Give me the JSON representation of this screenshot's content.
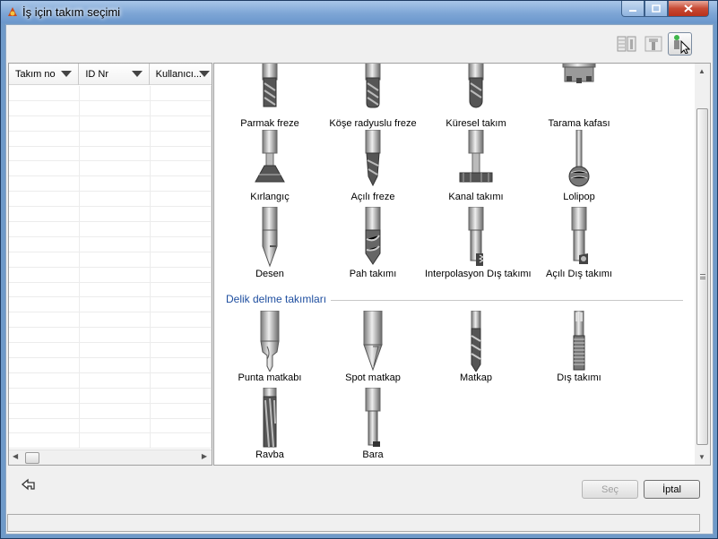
{
  "window": {
    "title": "İş için takım seçimi",
    "accent": "#6f9ac9"
  },
  "titlebar_buttons": {
    "minimize_icon": "minimize-icon",
    "maximize_icon": "maximize-icon",
    "close_icon": "close-icon"
  },
  "view_buttons": [
    "list-view-icon",
    "tool-view-icon",
    "graphic-view-icon"
  ],
  "table": {
    "columns": [
      "Takım no",
      "ID Nr",
      "Kullanıcı..."
    ]
  },
  "milling_tools": [
    {
      "label": "Parmak freze",
      "icon": "end-mill-icon"
    },
    {
      "label": "Köşe radyuslu freze",
      "icon": "corner-radius-mill-icon"
    },
    {
      "label": "Küresel takım",
      "icon": "ball-nose-mill-icon"
    },
    {
      "label": "Tarama kafası",
      "icon": "face-mill-head-icon"
    },
    {
      "label": "Kırlangıç",
      "icon": "dovetail-cutter-icon"
    },
    {
      "label": "Açılı freze",
      "icon": "angled-mill-icon"
    },
    {
      "label": "Kanal takımı",
      "icon": "slot-cutter-icon"
    },
    {
      "label": "Lolipop",
      "icon": "lollipop-cutter-icon"
    },
    {
      "label": "Desen",
      "icon": "engraving-tool-icon"
    },
    {
      "label": "Pah takımı",
      "icon": "chamfer-tool-icon"
    },
    {
      "label": "Interpolasyon Dış takımı",
      "icon": "interpolation-thread-tool-icon"
    },
    {
      "label": "Açılı Dış takımı",
      "icon": "angled-thread-tool-icon"
    }
  ],
  "drilling_section": {
    "title": "Delik delme takımları",
    "tools": [
      {
        "label": "Punta matkabı",
        "icon": "center-drill-icon"
      },
      {
        "label": "Spot matkap",
        "icon": "spot-drill-icon"
      },
      {
        "label": "Matkap",
        "icon": "drill-icon"
      },
      {
        "label": "Dış takımı",
        "icon": "tap-icon"
      },
      {
        "label": "Ravba",
        "icon": "reamer-icon"
      },
      {
        "label": "Bara",
        "icon": "boring-bar-icon"
      }
    ]
  },
  "footer": {
    "back_icon": "back-icon",
    "select_label": "Seç",
    "cancel_label": "İptal",
    "status_text": ""
  }
}
